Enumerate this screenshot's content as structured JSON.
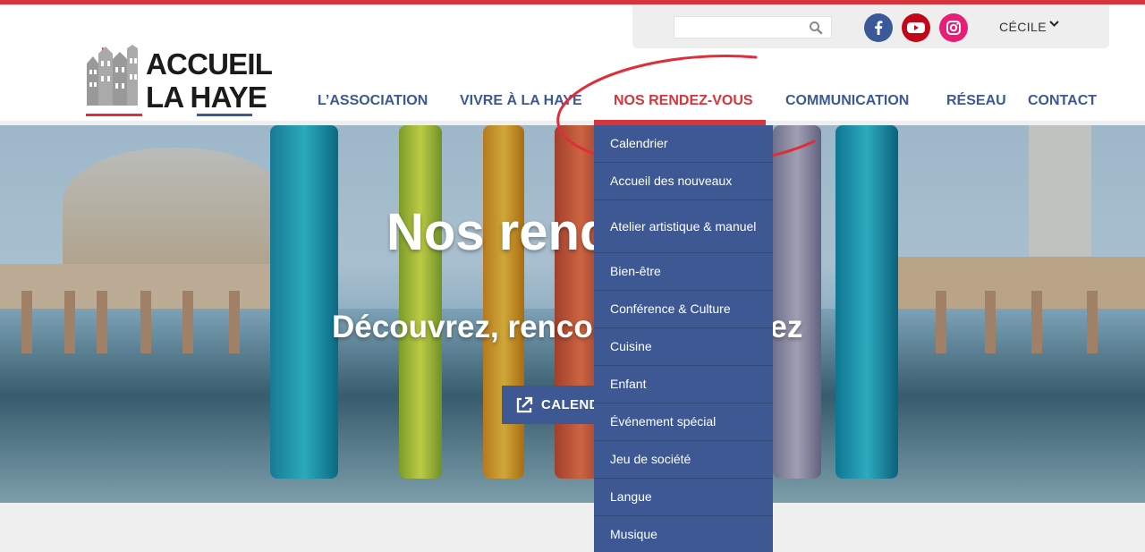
{
  "brand": {
    "line1": "ACCUEIL",
    "line2": "LA HAYE",
    "colors": {
      "red": "#d7343b",
      "blue": "#3d5892",
      "dark": "#1b1b1b"
    }
  },
  "utility": {
    "search_placeholder": "",
    "user_name": "CÉCILE",
    "icons": [
      "search-icon",
      "facebook-icon",
      "youtube-icon",
      "instagram-icon",
      "chevron-down-icon"
    ]
  },
  "nav": {
    "items": [
      {
        "label": "L’ASSOCIATION"
      },
      {
        "label": "VIVRE À LA HAYE"
      },
      {
        "label": "NOS RENDEZ-VOUS"
      },
      {
        "label": "COMMUNICATION"
      },
      {
        "label": "RÉSEAU"
      },
      {
        "label": "CONTACT"
      }
    ],
    "active_item": "NOS RENDEZ-VOUS"
  },
  "hero": {
    "title": "Nos rende",
    "subtitle": "Découvrez, rencor",
    "subtitle_suffix": "gez",
    "button_label": "CALEND"
  },
  "dropdown": {
    "items": [
      "Calendrier",
      "Accueil des nouveaux",
      "Atelier artistique & manuel",
      "Bien-être",
      "Conférence & Culture",
      "Cuisine",
      "Enfant",
      "Événement spécial",
      "Jeu de société",
      "Langue",
      "Musique"
    ]
  }
}
